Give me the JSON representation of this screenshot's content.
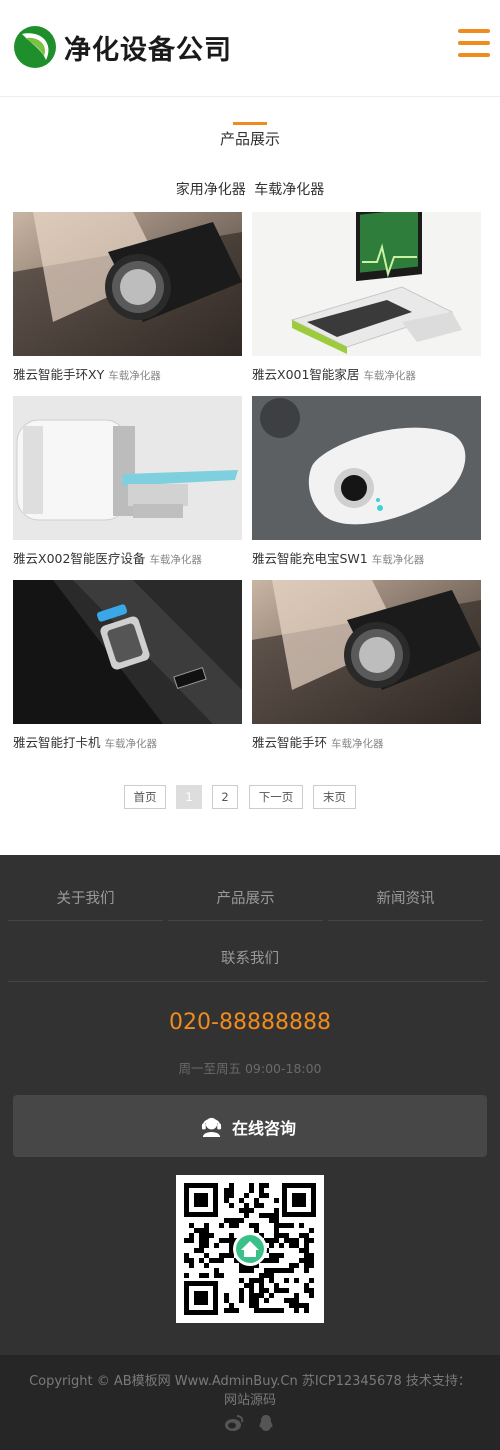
{
  "header": {
    "logo_text": "净化设备公司"
  },
  "section": {
    "title": "产品展示"
  },
  "categories": [
    "家用净化器",
    "车载净化器"
  ],
  "products": [
    {
      "name": "雅云智能手环XY",
      "tag": "车载净化器"
    },
    {
      "name": "雅云X001智能家居",
      "tag": "车载净化器"
    },
    {
      "name": "雅云X002智能医疗设备",
      "tag": "车载净化器"
    },
    {
      "name": "雅云智能充电宝SW1",
      "tag": "车载净化器"
    },
    {
      "name": "雅云智能打卡机",
      "tag": "车载净化器"
    },
    {
      "name": "雅云智能手环",
      "tag": "车载净化器"
    }
  ],
  "pagination": {
    "first": "首页",
    "page1": "1",
    "page2": "2",
    "next": "下一页",
    "last": "末页",
    "current": 1
  },
  "footer": {
    "nav": [
      "关于我们",
      "产品展示",
      "新闻资讯",
      "联系我们"
    ],
    "phone": "020-88888888",
    "hours": "周一至周五 09:00-18:00",
    "consult_label": "在线咨询"
  },
  "bottom": {
    "copyright_line1": "Copyright © AB模板网 Www.AdminBuy.Cn   苏ICP12345678   技术支持：",
    "copyright_line2": "网站源码"
  },
  "icons": [
    "logo-leaf-icon",
    "menu-icon",
    "headset-icon",
    "home-icon",
    "weibo-icon",
    "qq-icon"
  ],
  "colors": {
    "accent": "#f08c1e",
    "logo_green": "#2aa532",
    "footer_bg": "#323232",
    "bottom_bg": "#262626"
  }
}
